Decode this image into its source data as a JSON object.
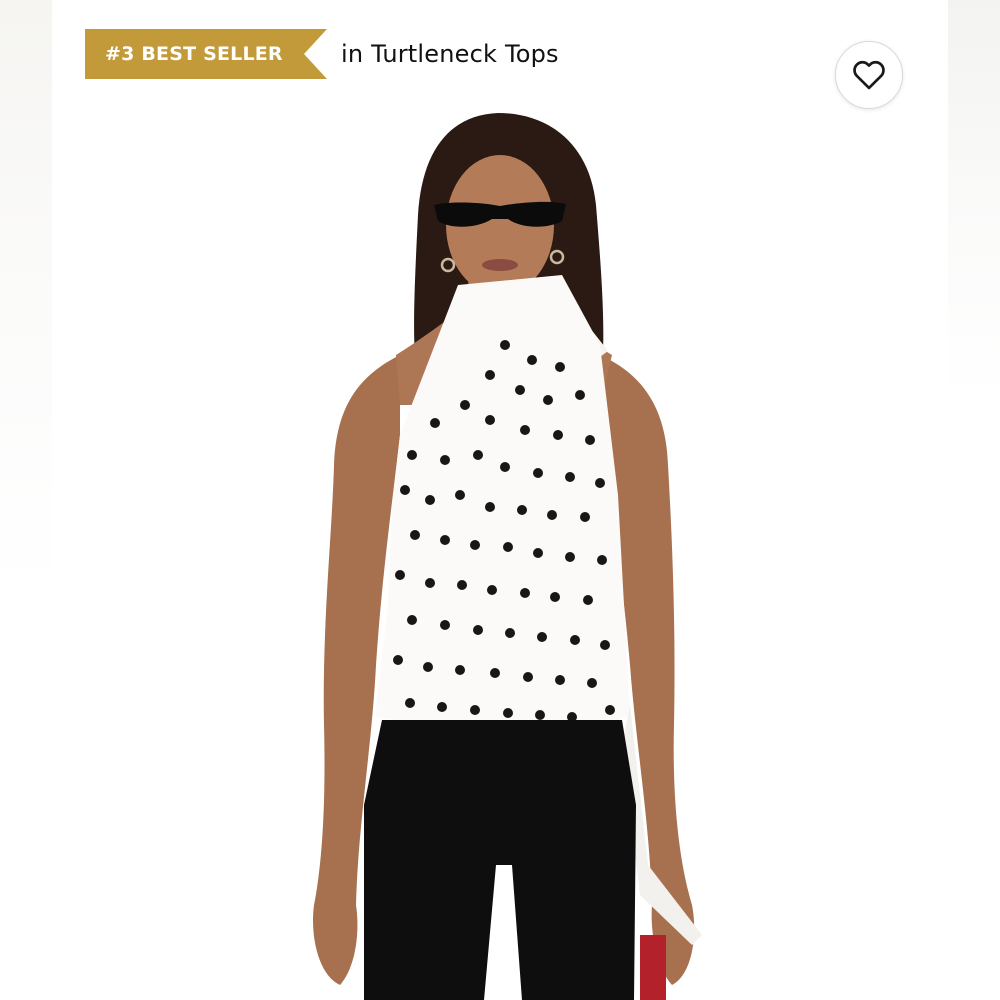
{
  "badge": {
    "rank_label": "#3 BEST SELLER",
    "context": "in Turtleneck Tops",
    "color": "#c29a39"
  },
  "wishlist": {
    "icon": "heart-icon"
  },
  "product_image": {
    "subject": "product-photo",
    "top_pattern": "polka-dot",
    "top_colors": [
      "#ffffff",
      "#1a1616"
    ],
    "pants_color": "#0e0e0e",
    "bag_color": "#b3222b"
  }
}
